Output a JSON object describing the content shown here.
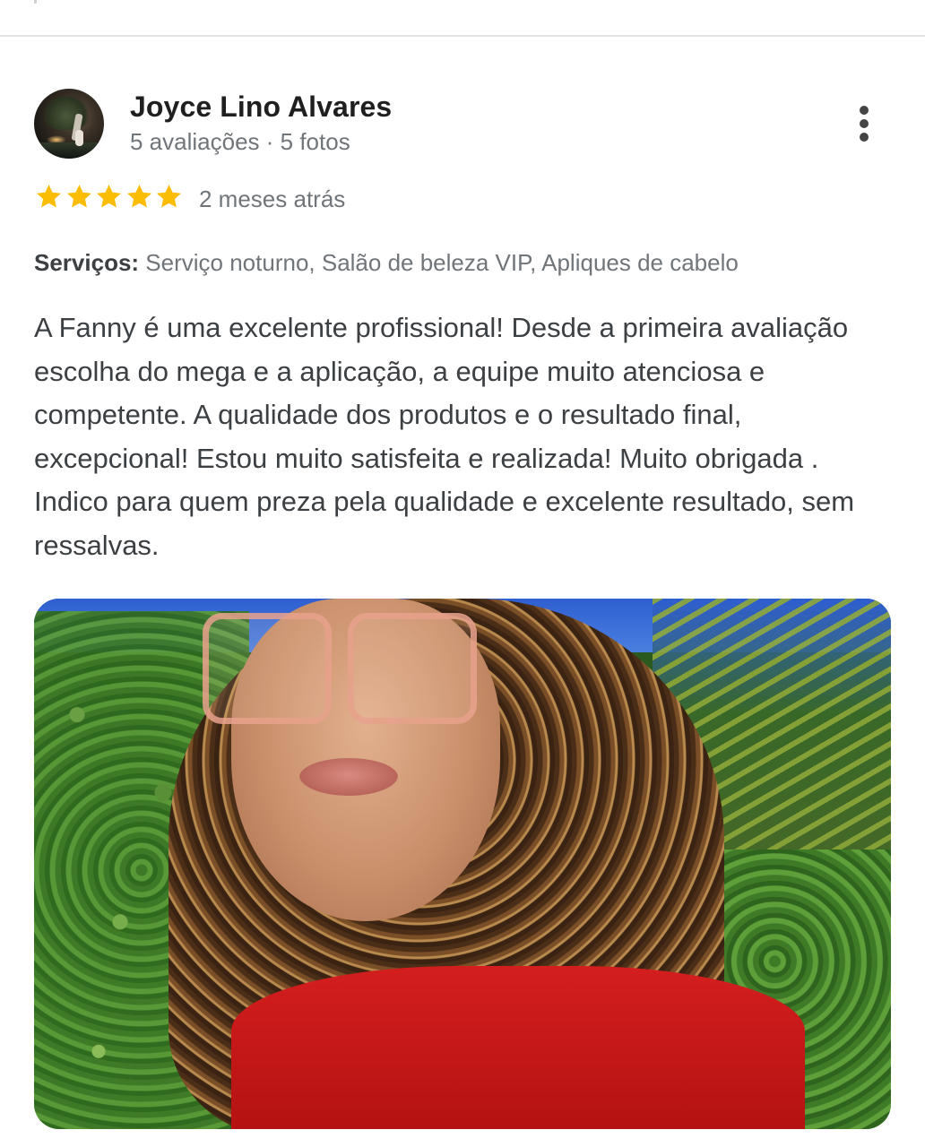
{
  "reviewer": {
    "name": "Joyce Lino Alvares",
    "meta": "5 avaliações · 5 fotos"
  },
  "rating": {
    "stars": 5,
    "max": 5,
    "star_color": "#fbbc04",
    "date": "2 meses atrás"
  },
  "services": {
    "label": "Serviços:",
    "value": " Serviço noturno, Salão de beleza VIP, Apliques de cabelo"
  },
  "review": {
    "text": "A Fanny é uma excelente profissional! Desde a primeira avaliação escolha do mega e a aplicação, a equipe muito atenciosa e competente. A qualidade dos produtos e o resultado final, excepcional! Estou muito satisfeita e realizada! Muito obrigada . Indico para quem preza pela qualidade e excelente resultado, sem ressalvas."
  },
  "icons": {
    "more": "more-vert-icon",
    "star": "star-icon"
  }
}
